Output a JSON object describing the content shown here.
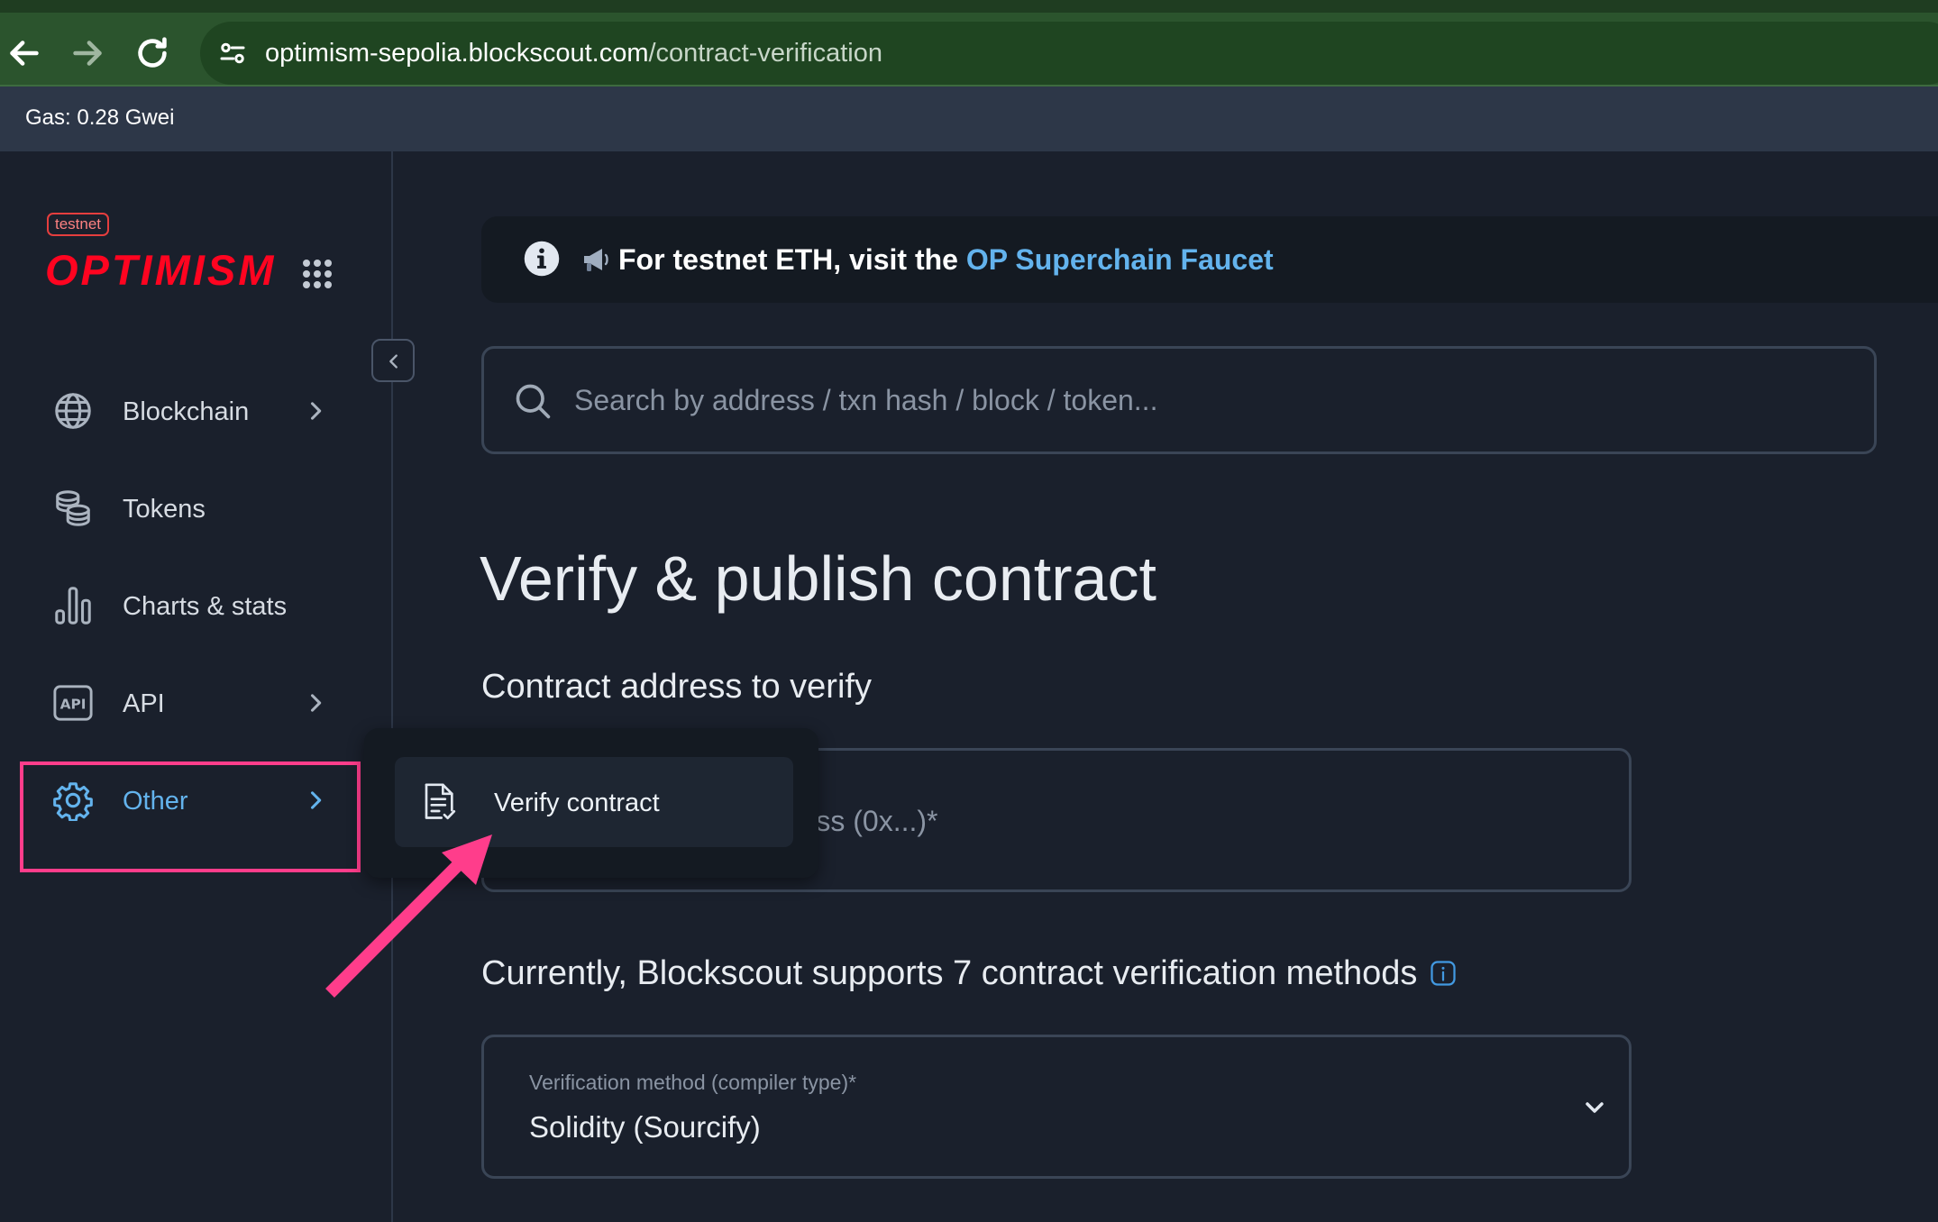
{
  "browser": {
    "url_domain": "optimism-sepolia.blockscout.com",
    "url_path": "/contract-verification"
  },
  "gas": {
    "text": "Gas: 0.28 Gwei"
  },
  "sidebar": {
    "badge": "testnet",
    "logo": "OPTIMISM",
    "items": [
      {
        "label": "Blockchain",
        "icon": "globe-icon",
        "has_chevron": true
      },
      {
        "label": "Tokens",
        "icon": "coins-icon",
        "has_chevron": false
      },
      {
        "label": "Charts & stats",
        "icon": "bar-chart-icon",
        "has_chevron": false
      },
      {
        "label": "API",
        "icon": "api-icon",
        "has_chevron": true
      },
      {
        "label": "Other",
        "icon": "gear-icon",
        "has_chevron": true,
        "active": true
      }
    ]
  },
  "popover": {
    "item_label": "Verify contract"
  },
  "banner": {
    "text": "For testnet ETH, visit the ",
    "link": "OP Superchain Faucet"
  },
  "search": {
    "placeholder": "Search by address / txn hash / block / token..."
  },
  "main": {
    "title": "Verify & publish contract",
    "address_section_title": "Contract address to verify",
    "address_placeholder": "Smart contract / Address (0x...)*",
    "methods_title": "Currently, Blockscout supports 7 contract verification methods",
    "method_label": "Verification method (compiler type)*",
    "method_value": "Solidity (Sourcify)"
  },
  "colors": {
    "accent": "#63b3ed",
    "brand": "#ff0420",
    "highlight": "#ff3d8b",
    "background": "#1a202c"
  }
}
